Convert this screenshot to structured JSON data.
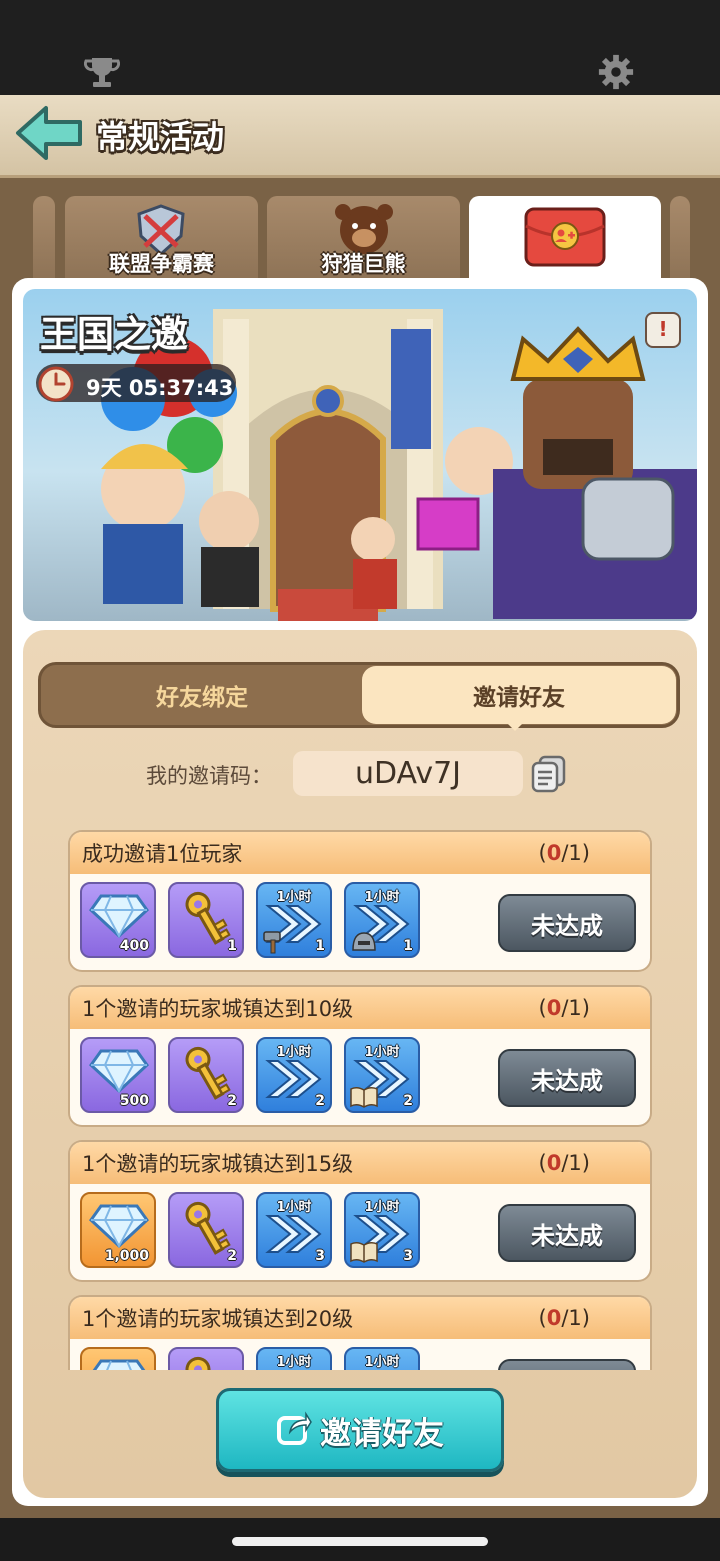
{
  "header": {
    "title": "常规活动"
  },
  "tabs": [
    {
      "label": "联盟争霸赛",
      "icon": "shield-swords-icon"
    },
    {
      "label": "狩猎巨熊",
      "icon": "bear-head-icon"
    },
    {
      "label": "",
      "icon": "red-envelope-friend-icon"
    }
  ],
  "banner": {
    "title": "王国之邀",
    "timer": "9天 05:37:43",
    "info": "!"
  },
  "segments": {
    "left": "好友绑定",
    "right": "邀请好友"
  },
  "invite_code": {
    "label": "我的邀请码：",
    "code": "uDAv7J"
  },
  "tasks": [
    {
      "title": "成功邀请1位玩家",
      "progress_current": "0",
      "progress_total": "/1)",
      "progress_open": "(",
      "status": "未达成",
      "rewards": [
        {
          "type": "gem",
          "qty": "400",
          "top": ""
        },
        {
          "type": "key",
          "qty": "1",
          "top": ""
        },
        {
          "type": "speedup-hammer",
          "qty": "1",
          "top": "1小时"
        },
        {
          "type": "speedup-helmet",
          "qty": "1",
          "top": "1小时"
        }
      ]
    },
    {
      "title": "1个邀请的玩家城镇达到10级",
      "progress_current": "0",
      "progress_total": "/1)",
      "progress_open": "(",
      "status": "未达成",
      "rewards": [
        {
          "type": "gem",
          "qty": "500",
          "top": ""
        },
        {
          "type": "key",
          "qty": "2",
          "top": ""
        },
        {
          "type": "speedup",
          "qty": "2",
          "top": "1小时"
        },
        {
          "type": "speedup-book",
          "qty": "2",
          "top": "1小时"
        }
      ]
    },
    {
      "title": "1个邀请的玩家城镇达到15级",
      "progress_current": "0",
      "progress_total": "/1)",
      "progress_open": "(",
      "status": "未达成",
      "rewards": [
        {
          "type": "gem",
          "qty": "1,000",
          "top": ""
        },
        {
          "type": "key",
          "qty": "2",
          "top": ""
        },
        {
          "type": "speedup",
          "qty": "3",
          "top": "1小时"
        },
        {
          "type": "speedup-book",
          "qty": "3",
          "top": "1小时"
        }
      ]
    },
    {
      "title": "1个邀请的玩家城镇达到20级",
      "progress_current": "0",
      "progress_total": "/1)",
      "progress_open": "(",
      "status": "",
      "rewards": [
        {
          "type": "gem",
          "qty": "",
          "top": ""
        },
        {
          "type": "key",
          "qty": "",
          "top": ""
        },
        {
          "type": "speedup",
          "qty": "",
          "top": "1小时"
        },
        {
          "type": "speedup",
          "qty": "",
          "top": "1小时"
        }
      ]
    }
  ],
  "bottom_button": {
    "label": "邀请好友"
  },
  "colors": {
    "accent_teal": "#1eb7c2",
    "progress_red": "#c0392b",
    "panel_bg": "#ecd7b8"
  }
}
